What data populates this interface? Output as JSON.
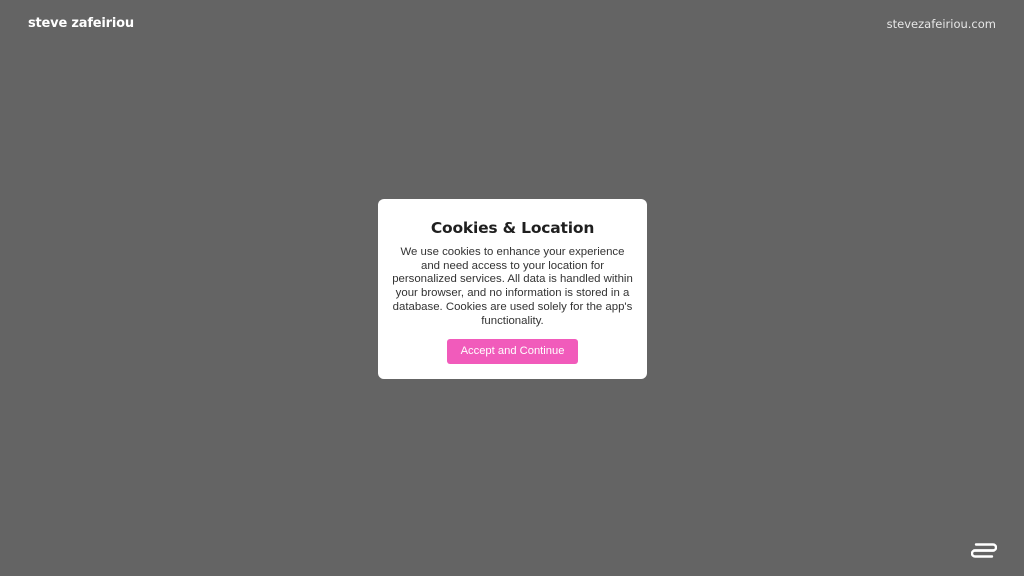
{
  "header": {
    "brand": "steve zafeiriou",
    "site_link": "stevezafeiriou.com"
  },
  "modal": {
    "title": "Cookies & Location",
    "body": "We use cookies to enhance your experience and need access to your location for personalized services. All data is handled within your browser, and no information is stored in a database. Cookies are used solely for the app's functionality.",
    "button_label": "Accept and Continue"
  },
  "colors": {
    "background": "#646464",
    "modal_background": "#ffffff",
    "accent": "#f15bbb"
  },
  "icons": {
    "corner_logo": "brand-logo-icon"
  }
}
